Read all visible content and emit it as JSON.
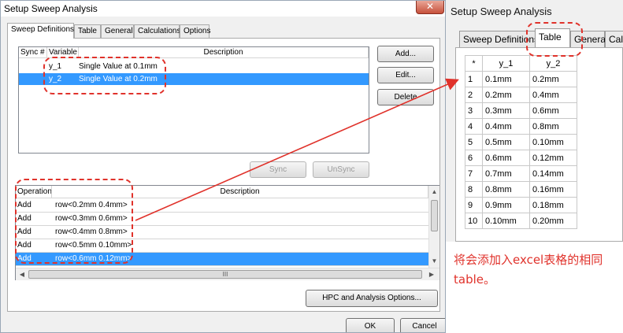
{
  "dialog": {
    "title": "Setup Sweep Analysis",
    "close_label": "✕",
    "tabs": [
      {
        "label": "Sweep Definitions",
        "active": true
      },
      {
        "label": "Table",
        "active": false
      },
      {
        "label": "General",
        "active": false
      },
      {
        "label": "Calculations",
        "active": false
      },
      {
        "label": "Options",
        "active": false
      }
    ],
    "sweep_table": {
      "headers": {
        "sync": "Sync #",
        "variable": "Variable",
        "description": "Description"
      },
      "rows": [
        {
          "sync": "",
          "variable": "y_1",
          "description": "Single Value at 0.1mm",
          "selected": false
        },
        {
          "sync": "",
          "variable": "y_2",
          "description": "Single Value at 0.2mm",
          "selected": true
        }
      ]
    },
    "buttons": {
      "add": "Add...",
      "edit": "Edit...",
      "delete": "Delete",
      "sync": "Sync",
      "unsync": "UnSync",
      "hpc": "HPC and Analysis Options...",
      "ok": "OK",
      "cancel": "Cancel"
    },
    "operation_table": {
      "headers": {
        "operation": "Operation",
        "description": "Description"
      },
      "rows": [
        {
          "operation": "Add",
          "description": "row<0.2mm 0.4mm>",
          "selected": false
        },
        {
          "operation": "Add",
          "description": "row<0.3mm 0.6mm>",
          "selected": false
        },
        {
          "operation": "Add",
          "description": "row<0.4mm 0.8mm>",
          "selected": false
        },
        {
          "operation": "Add",
          "description": "row<0.5mm 0.10mm>",
          "selected": false
        },
        {
          "operation": "Add",
          "description": "row<0.6mm 0.12mm>",
          "selected": true
        }
      ],
      "hscroll_grip": "III"
    }
  },
  "table_view": {
    "title": "Setup Sweep Analysis",
    "tabs": [
      {
        "label": "Sweep Definitions",
        "active": false
      },
      {
        "label": "Table",
        "active": true
      },
      {
        "label": "General",
        "active": false
      },
      {
        "label": "Cal",
        "active": false
      }
    ],
    "columns": [
      "*",
      "y_1",
      "y_2"
    ],
    "rows": [
      [
        "1",
        "0.1mm",
        "0.2mm"
      ],
      [
        "2",
        "0.2mm",
        "0.4mm"
      ],
      [
        "3",
        "0.3mm",
        "0.6mm"
      ],
      [
        "4",
        "0.4mm",
        "0.8mm"
      ],
      [
        "5",
        "0.5mm",
        "0.10mm"
      ],
      [
        "6",
        "0.6mm",
        "0.12mm"
      ],
      [
        "7",
        "0.7mm",
        "0.14mm"
      ],
      [
        "8",
        "0.8mm",
        "0.16mm"
      ],
      [
        "9",
        "0.9mm",
        "0.18mm"
      ],
      [
        "10",
        "0.10mm",
        "0.20mm"
      ]
    ]
  },
  "annotation": {
    "caption": "将会添加入excel表格的相同table。",
    "color": "#e0322b"
  }
}
